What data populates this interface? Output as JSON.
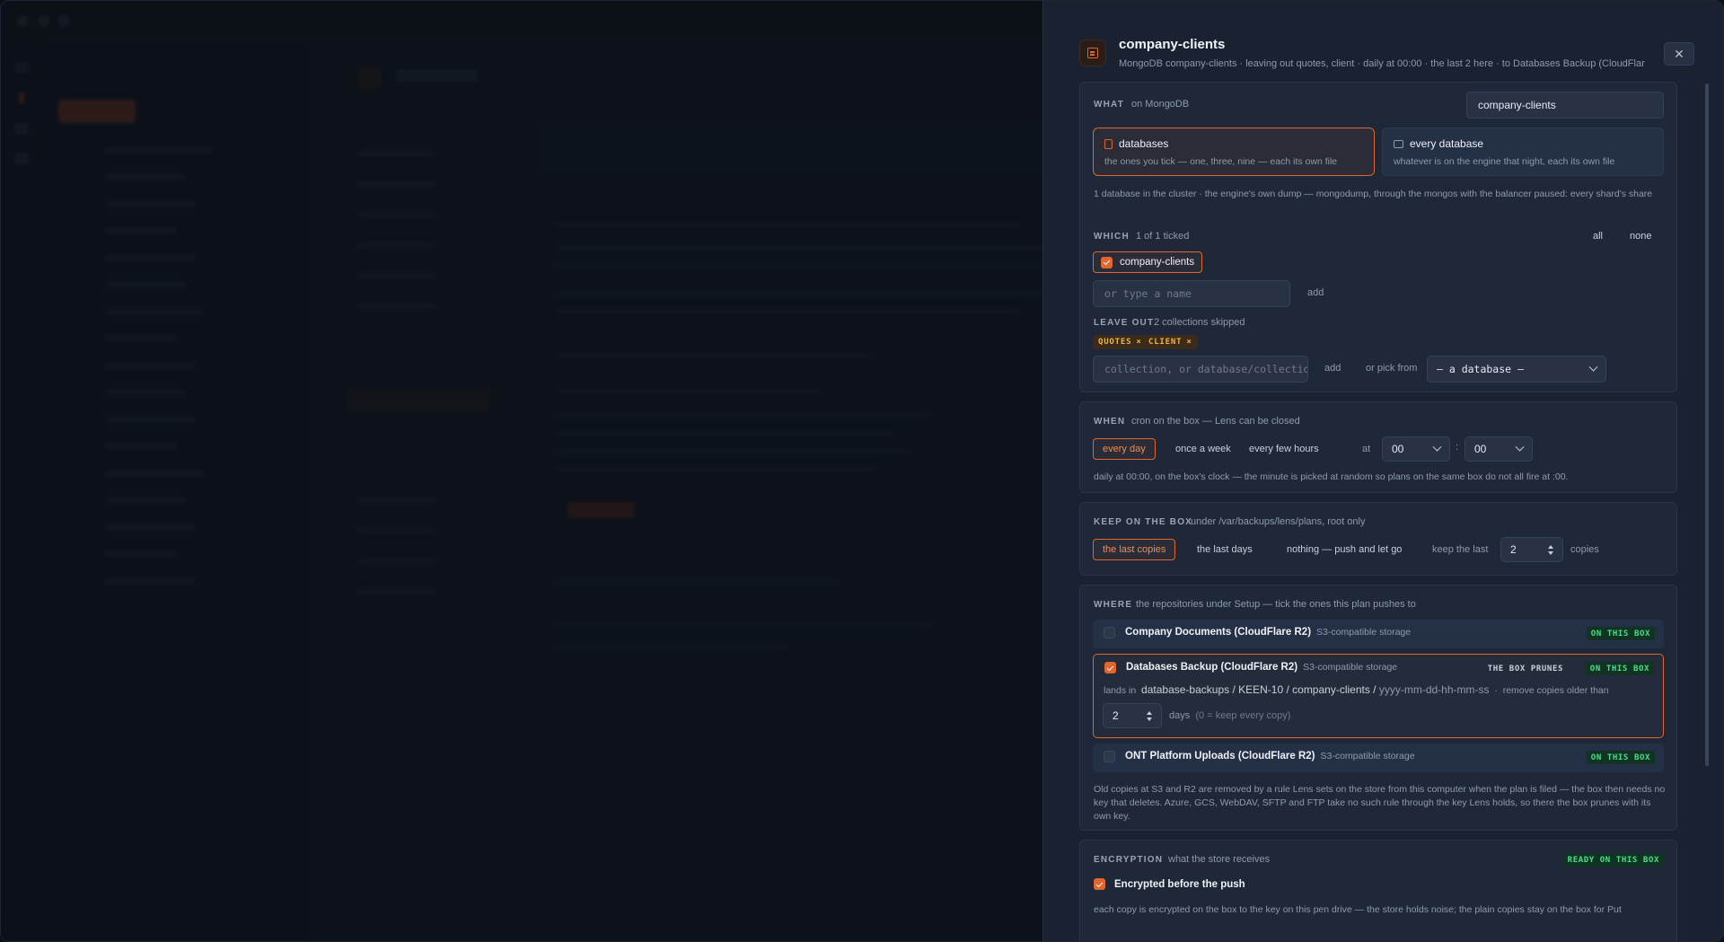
{
  "drawer": {
    "title": "company-clients",
    "subtitle": "MongoDB company-clients · leaving out quotes, client · daily at 00:00 · the last 2 here · to Databases Backup (CloudFlar",
    "close_glyph": "✕"
  },
  "what": {
    "label": "WHAT",
    "note": "on MongoDB",
    "name_value": "company-clients",
    "options": [
      {
        "title": "databases",
        "desc": "the ones you tick — one, three, nine — each its own file"
      },
      {
        "title": "every database",
        "desc": "whatever is on the engine that night, each its own file"
      }
    ],
    "info": "1 database in the cluster · the engine's own dump — mongodump, through the mongos with the balancer paused: every shard's share",
    "which_label": "WHICH",
    "which_note": "1 of 1 ticked",
    "all_label": "all",
    "none_label": "none",
    "ticked_db": "company-clients",
    "type_placeholder": "or type a name",
    "add_label": "add",
    "leave_out_label": "LEAVE OUT",
    "leave_out_note": "2 collections skipped",
    "tags": [
      "QUOTES",
      "CLIENT"
    ],
    "tag_x": "×",
    "collection_placeholder": "collection, or database/collection",
    "add_label_2": "add",
    "pick_from_label": "or pick from",
    "pick_from_value": "– a database –"
  },
  "when": {
    "label": "WHEN",
    "note": "cron on the box — Lens can be closed",
    "modes": [
      "every day",
      "once a week",
      "every few hours"
    ],
    "at_label": "at",
    "hour": "00",
    "colon": ":",
    "minute": "00",
    "info": "daily at 00:00, on the box's clock — the minute is picked at random so plans on the same box do not all fire at :00."
  },
  "keep": {
    "label": "KEEP ON THE BOX",
    "note": "under /var/backups/lens/plans, root only",
    "modes": [
      "the last copies",
      "the last days",
      "nothing — push and let go"
    ],
    "keep_the_last": "keep the last",
    "count": "2",
    "unit": "copies"
  },
  "where": {
    "label": "WHERE",
    "note": "the repositories under Setup — tick the ones this plan pushes to",
    "repos": [
      {
        "name": "Company Documents (CloudFlare R2)",
        "type": "S3-compatible storage",
        "status": "ON THIS BOX"
      },
      {
        "name": "Databases Backup (CloudFlare R2)",
        "type": "S3-compatible storage",
        "prune": "THE BOX PRUNES",
        "status": "ON THIS BOX",
        "lands_in": "lands in",
        "path": "database-backups / KEEN-10 / company-clients / ",
        "path_tail": "yyyy-mm-dd-hh-mm-ss",
        "dot": "·",
        "remove_note": "remove copies older than",
        "days_value": "2",
        "days_label": "days",
        "days_hint": "(0 = keep every copy)"
      },
      {
        "name": "ONT Platform Uploads (CloudFlare R2)",
        "type": "S3-compatible storage",
        "status": "ON THIS BOX"
      }
    ],
    "info": "Old copies at S3 and R2 are removed by a rule Lens sets on the store from this computer when the plan is filed — the box then needs no key that deletes. Azure, GCS, WebDAV, SFTP and FTP take no such rule through the key Lens holds, so there the box prunes with its own key."
  },
  "encryption": {
    "label": "ENCRYPTION",
    "note": "what the store receives",
    "status": "READY ON THIS BOX",
    "check_label": "Encrypted before the push",
    "info": "each copy is encrypted on the box to the key on this pen drive — the store holds noise; the plain copies stay on the box for Put"
  },
  "colors": {
    "accent": "#e0662f",
    "ok": "#45e08a",
    "tag": "#f2b24a"
  }
}
